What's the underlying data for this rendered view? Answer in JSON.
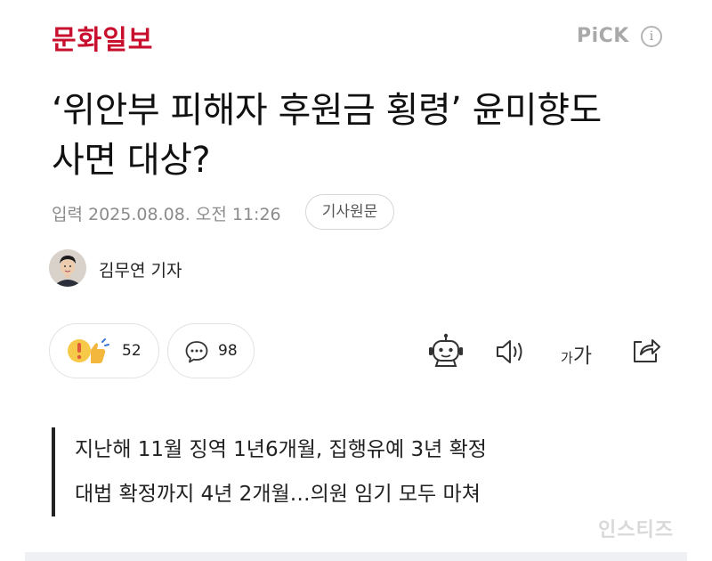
{
  "header": {
    "logo": "문화일보",
    "pick_label": "PiCK",
    "info_glyph": "i"
  },
  "article": {
    "title_line1": "‘위안부 피해자 후원금 횡령’ 윤미향도",
    "title_line2": "사면 대상?",
    "date": "입력 2025.08.08. 오전 11:26",
    "original_button": "기사원문",
    "reporter": "김무연 기자",
    "summary_line1": "지난해 11월 징역 1년6개월, 집행유예 3년 확정",
    "summary_line2": "대법 확정까지 4년 2개월…의원 임기 모두 마쳐"
  },
  "actions": {
    "reaction_count": "52",
    "comment_count": "98",
    "font_size_label_small": "가",
    "font_size_label_large": "가",
    "icons": [
      "reaction-icon",
      "comment-icon",
      "robot-summary-icon",
      "audio-icon",
      "font-size-icon",
      "share-icon"
    ]
  },
  "watermark": "인스티즈",
  "colors": {
    "brand": "#c8102e",
    "muted": "#8b8b8b",
    "pick": "#a9a9a9"
  }
}
